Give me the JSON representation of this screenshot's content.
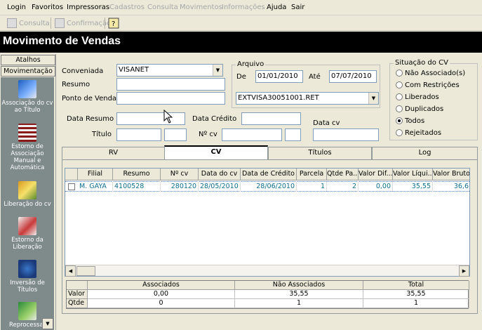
{
  "menu": {
    "items": [
      {
        "label": "Login",
        "disabled": false
      },
      {
        "label": "Favoritos",
        "disabled": false
      },
      {
        "label": "Impressoras",
        "disabled": false
      },
      {
        "label": "Cadastros",
        "disabled": true
      },
      {
        "label": "Consulta",
        "disabled": true
      },
      {
        "label": "Movimentos",
        "disabled": true
      },
      {
        "label": "Informações",
        "disabled": true
      },
      {
        "label": "Ajuda",
        "disabled": false
      },
      {
        "label": "Sair",
        "disabled": false
      }
    ]
  },
  "toolbar": {
    "consulta_label": "Consulta",
    "confirmacao_label": "Confirmação"
  },
  "window": {
    "title": "Movimento de Vendas"
  },
  "sidebar": {
    "atalhos_label": "Atalhos",
    "movimentacao_label": "Movimentação",
    "items": [
      {
        "label": "Associação do cv ao Título",
        "icon": "book-association-icon"
      },
      {
        "label": "Estorno de Associação Manual e Automática",
        "icon": "calendar-reversal-icon"
      },
      {
        "label": "Liberação do cv",
        "icon": "release-document-icon"
      },
      {
        "label": "Estorno da Liberação",
        "icon": "release-reversal-icon"
      },
      {
        "label": "Inversão de Títulos",
        "icon": "invert-titles-icon"
      },
      {
        "label": "Reprocessar",
        "icon": "reprocess-icon"
      }
    ]
  },
  "form": {
    "conveniada_label": "Conveniada",
    "conveniada_value": "VISANET",
    "resumo_label": "Resumo",
    "resumo_value": "",
    "ponto_label": "Ponto de Venda",
    "ponto_value": "",
    "data_resumo_label": "Data Resumo",
    "data_credito_label": "Data Crédito",
    "data_cv_label": "Data cv",
    "titulo_label": "Título",
    "ncv_label": "Nº cv"
  },
  "arquivo": {
    "group_label": "Arquivo",
    "de_label": "De",
    "de_value": "01/01/2010",
    "ate_label": "Até",
    "ate_value": "07/07/2010",
    "file_value": "EXTVISA30051001.RET"
  },
  "situacao": {
    "group_label": "Situação do CV",
    "options": [
      {
        "label": "Não Associado(s)",
        "selected": false
      },
      {
        "label": "Com Restrições",
        "selected": false
      },
      {
        "label": "Liberados",
        "selected": false
      },
      {
        "label": "Duplicados",
        "selected": false
      },
      {
        "label": "Todos",
        "selected": true
      },
      {
        "label": "Rejeitados",
        "selected": false
      }
    ]
  },
  "tabs": [
    {
      "label": "RV",
      "active": false
    },
    {
      "label": "CV",
      "active": true
    },
    {
      "label": "Títulos",
      "active": false
    },
    {
      "label": "Log",
      "active": false
    }
  ],
  "grid": {
    "columns": [
      "Filial",
      "Resumo",
      "Nº cv",
      "Data do cv",
      "Data de Crédito",
      "Parcela",
      "Qtde Pa...",
      "Valor Dif...",
      "Valor Líqui...",
      "Valor Bruto..."
    ],
    "rows": [
      [
        "M. GAYA",
        "4100528",
        "280120",
        "28/05/2010",
        "28/06/2010",
        "1",
        "2",
        "0,00",
        "35,55",
        "36,6"
      ]
    ]
  },
  "summary": {
    "headers": [
      "Associados",
      "Não Associados",
      "Total"
    ],
    "rows": [
      {
        "label": "Valor",
        "values": [
          "0,00",
          "35,55",
          "35,55"
        ]
      },
      {
        "label": "Qtde",
        "values": [
          "0",
          "1",
          "1"
        ]
      }
    ]
  }
}
